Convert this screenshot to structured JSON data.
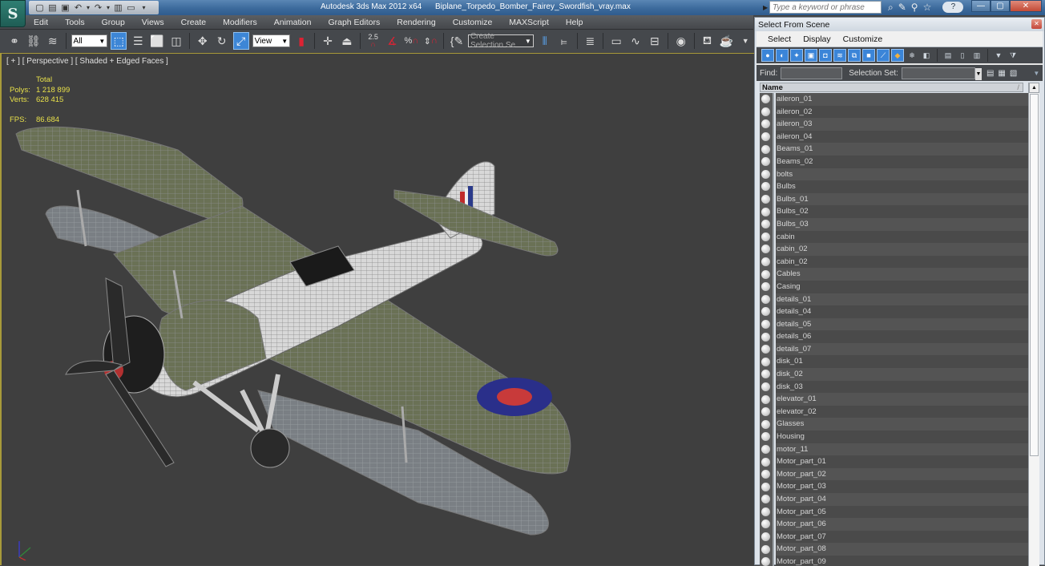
{
  "titlebar": {
    "app_title": "Autodesk 3ds Max  2012 x64",
    "file_name": "Biplane_Torpedo_Bomber_Fairey_Swordfish_vray.max",
    "search_placeholder": "Type a keyword or phrase",
    "logo_glyph": "S",
    "quick_access_icons": [
      "new-file-icon",
      "open-file-icon",
      "save-icon",
      "undo-icon",
      "redo-icon",
      "project-folder-icon",
      "window-icon",
      "dropdown-icon"
    ],
    "right_icons": [
      "binoculars-icon",
      "wrench-icon",
      "satellite-icon",
      "star-icon"
    ],
    "help_label": "?",
    "window_controls": {
      "minimize": "—",
      "maximize": "▢",
      "close": "✕"
    }
  },
  "menubar": {
    "items": [
      "Edit",
      "Tools",
      "Group",
      "Views",
      "Create",
      "Modifiers",
      "Animation",
      "Graph Editors",
      "Rendering",
      "Customize",
      "MAXScript",
      "Help"
    ]
  },
  "toolbar": {
    "selection_filter": "All",
    "reference_coord": "View",
    "named_selection_placeholder": "Create Selection Se",
    "snap_label": "2.5",
    "icons": [
      "link-icon",
      "unlink-icon",
      "bind-space-warp-icon",
      "select-object-icon",
      "select-by-name-icon",
      "rectangular-selection-icon",
      "window-crossing-icon",
      "move-icon",
      "rotate-icon",
      "scale-icon",
      "use-pivot-icon",
      "select-manipulate-icon",
      "keyboard-shortcut-icon",
      "snap-toggle-icon",
      "angle-snap-icon",
      "percent-snap-icon",
      "spinner-snap-icon",
      "edit-named-selection-icon",
      "mirror-icon",
      "align-icon",
      "layer-manager-icon",
      "scene-explorer-icon",
      "curve-editor-icon",
      "schematic-view-icon",
      "material-editor-icon",
      "render-setup-icon",
      "render-frame-icon",
      "render-icon"
    ]
  },
  "viewport": {
    "label": "[ + ] [ Perspective ] [ Shaded + Edged Faces ]",
    "stats": {
      "header": "Total",
      "polys_label": "Polys:",
      "polys_value": "1 218 899",
      "verts_label": "Verts:",
      "verts_value": "628 415",
      "fps_label": "FPS:",
      "fps_value": "86.684"
    },
    "colors": {
      "stats_text": "#e8e04a",
      "border": "#a89a3a",
      "background": "#3f3f3f"
    }
  },
  "dialog": {
    "title": "Select From Scene",
    "menu": [
      "Select",
      "Display",
      "Customize"
    ],
    "filter_icons": [
      "geometry-filter-icon",
      "shapes-filter-icon",
      "lights-filter-icon",
      "cameras-filter-icon",
      "helpers-filter-icon",
      "space-warps-filter-icon",
      "groups-filter-icon",
      "xrefs-filter-icon",
      "bones-filter-icon",
      "containers-filter-icon",
      "frozen-filter-icon",
      "hidden-filter-icon"
    ],
    "action_icons": [
      "select-all-icon",
      "select-none-icon",
      "select-invert-icon",
      "filter-icon",
      "filter-options-icon"
    ],
    "find_label": "Find:",
    "find_value": "",
    "selection_set_label": "Selection Set:",
    "selection_set_value": "",
    "column_header": "Name",
    "items": [
      "aileron_01",
      "aileron_02",
      "aileron_03",
      "aileron_04",
      "Beams_01",
      "Beams_02",
      "bolts",
      "Bulbs",
      "Bulbs_01",
      "Bulbs_02",
      "Bulbs_03",
      "cabin",
      "cabin_02",
      "cabin_02",
      "Cables",
      "Casing",
      "details_01",
      "details_04",
      "details_05",
      "details_06",
      "details_07",
      "disk_01",
      "disk_02",
      "disk_03",
      "elevator_01",
      "elevator_02",
      "Glasses",
      "Housing",
      "motor_11",
      "Motor_part_01",
      "Motor_part_02",
      "Motor_part_03",
      "Motor_part_04",
      "Motor_part_05",
      "Motor_part_06",
      "Motor_part_07",
      "Motor_part_08",
      "Motor_part_09"
    ]
  }
}
